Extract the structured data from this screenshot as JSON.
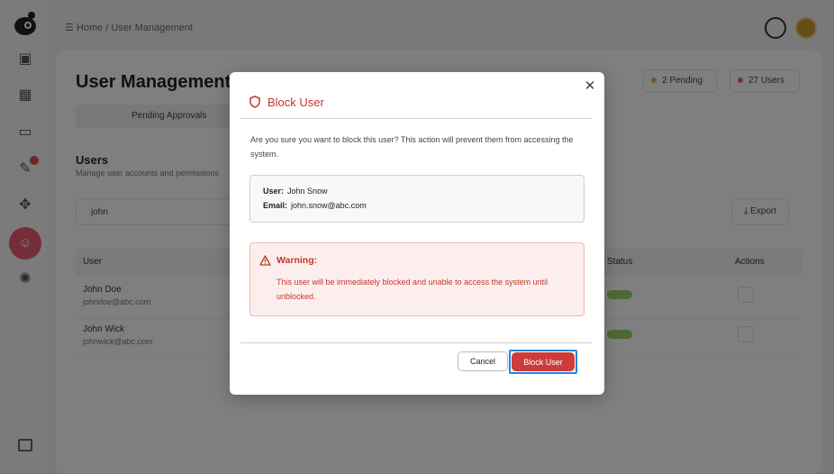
{
  "background": {
    "breadcrumb": "☰ Home / User Management",
    "page_title": "User Management",
    "tab_label": "Pending Approvals",
    "stats": [
      {
        "label": "2 Pending",
        "color": "#f0ad4e"
      },
      {
        "label": "27 Users",
        "color": "#e85a72"
      }
    ],
    "users_title": "Users",
    "users_subtitle": "Manage user accounts and permissions",
    "search_value": "john",
    "export_label": "⤓ Export",
    "table_headers": {
      "user": "User",
      "status": "Status",
      "actions": "Actions"
    },
    "rows": [
      {
        "name": "John Doe",
        "email": "johndoe@abc.com"
      },
      {
        "name": "John Wick",
        "email": "johnwick@abc.com"
      }
    ]
  },
  "modal": {
    "title": "Block User",
    "description": "Are you sure you want to block this user? This action will prevent them from accessing the system.",
    "user_label": "User:",
    "user_value": "John Snow",
    "email_label": "Email:",
    "email_value": "john.snow@abc.com",
    "warning_title": "Warning:",
    "warning_text": "This user will be immediately blocked and unable to access the system until unblocked.",
    "cancel_label": "Cancel",
    "confirm_label": "Block User",
    "close_symbol": "✕"
  },
  "colors": {
    "danger": "#cf3b3b",
    "danger_text": "#c0392b",
    "warning_bg": "#fdeeee",
    "focus_ring": "#1e88e5"
  }
}
